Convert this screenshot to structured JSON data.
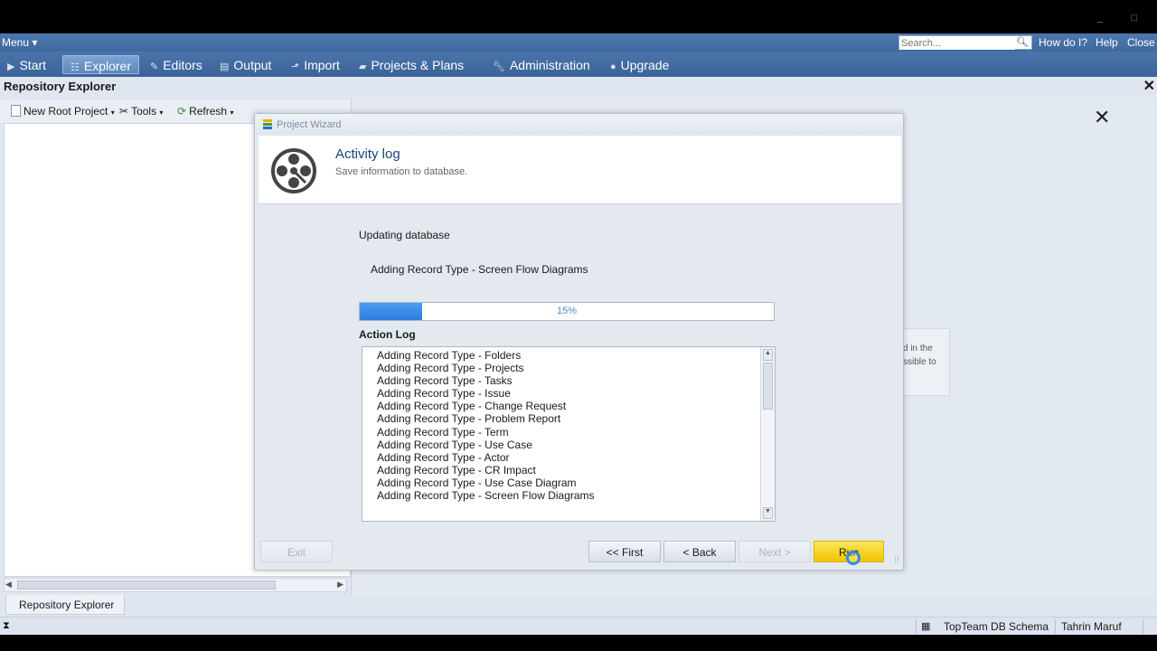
{
  "menu": {
    "menu_label": "Menu ▾",
    "search_placeholder": "Search...",
    "how_do_i": "How do I?",
    "help": "Help",
    "close": "Close"
  },
  "nav": {
    "tabs": [
      {
        "label": "Start",
        "icon": "arrow-right-icon"
      },
      {
        "label": "Explorer",
        "icon": "tree-icon",
        "active": true
      },
      {
        "label": "Editors",
        "icon": "editor-icon"
      },
      {
        "label": "Output",
        "icon": "output-icon"
      },
      {
        "label": "Import",
        "icon": "import-icon"
      },
      {
        "label": "Projects & Plans",
        "icon": "folder-icon"
      },
      {
        "label": "Administration",
        "icon": "wrench-icon"
      },
      {
        "label": "Upgrade",
        "icon": "globe-icon"
      }
    ]
  },
  "panel": {
    "title": "Repository Explorer",
    "toolbar": {
      "new_root_project": "New Root Project",
      "tools": "Tools",
      "refresh": "Refresh"
    }
  },
  "background_card": {
    "line1": "d in the",
    "line2": "ssible to"
  },
  "wizard": {
    "window_title": "Project Wizard",
    "heading": "Activity log",
    "subheading": "Save information to database.",
    "updating_label": "Updating database",
    "current_action": "Adding Record Type - Screen Flow Diagrams",
    "progress_percent": 15,
    "progress_text": "15%",
    "action_log_label": "Action Log",
    "log_lines": [
      "Adding Record Type - Folders",
      "Adding Record Type - Projects",
      "Adding Record Type - Tasks",
      "Adding Record Type - Issue",
      "Adding Record Type - Change Request",
      "Adding Record Type - Problem Report",
      "Adding Record Type - Term",
      "Adding Record Type - Use Case",
      "Adding Record Type - Actor",
      "Adding Record Type - CR Impact",
      "Adding Record Type - Use Case Diagram",
      "Adding Record Type - Screen Flow Diagrams"
    ],
    "buttons": {
      "exit": "Exit",
      "first": "<< First",
      "back": "< Back",
      "next": "Next >",
      "run": "Run"
    }
  },
  "bottom_tab": "Repository Explorer",
  "status": {
    "schema": "TopTeam DB Schema",
    "user": "Tahrin Maruf"
  },
  "colors": {
    "ribbon": "#4a74aa",
    "progress_fill": "#2b7fdc",
    "run_button": "#f3c400"
  }
}
